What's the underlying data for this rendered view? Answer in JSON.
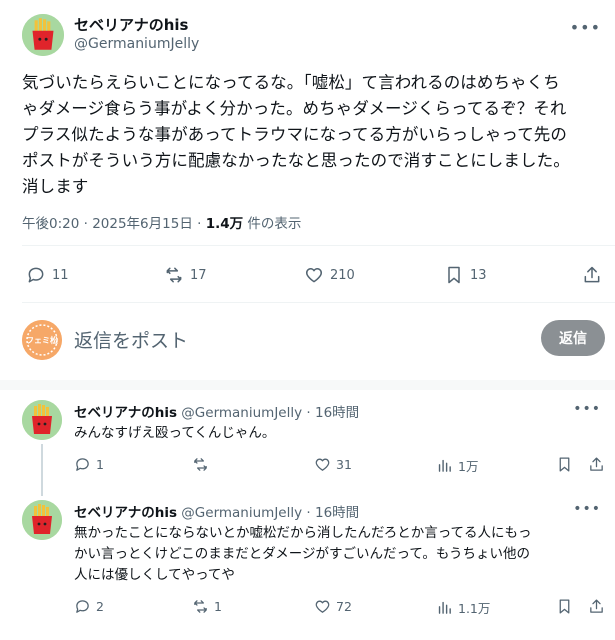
{
  "post": {
    "display_name": "セベリアナのhis",
    "handle": "@GermaniumJelly",
    "text_lines": [
      "気づいたらえらいことになってるな。「嘘松」て言われるのはめちゃくち",
      "ゃダメージ食らう事がよく分かった。めちゃダメージくらってるぞ？それ",
      "プラス似たような事があってトラウマになってる方がいらっしゃって先の",
      "ポストがそういう方に配慮なかったなと思ったので消すことにしました。",
      "消します"
    ],
    "timestamp": "午後0:20 · 2025年6月15日 · ",
    "views_count": "1.4万",
    "views_label": " 件の表示",
    "stats": {
      "replies": "11",
      "reposts": "17",
      "likes": "210",
      "bookmarks": "13"
    }
  },
  "composer": {
    "avatar_label": "フェミ松",
    "placeholder": "返信をポスト",
    "button_label": "返信"
  },
  "replies": [
    {
      "display_name": "セベリアナのhis",
      "handle_time": " @GermaniumJelly · 16時間",
      "text_lines": [
        "みんなすげえ殴ってくんじゃん。"
      ],
      "stats": {
        "replies": "1",
        "reposts": "",
        "likes": "31",
        "views": "1万"
      }
    },
    {
      "display_name": "セベリアナのhis",
      "handle_time": " @GermaniumJelly · 16時間",
      "text_lines": [
        "無かったことにならないとか嘘松だから消したんだろとか言ってる人にもっ",
        "かい言っとくけどこのままだとダメージがすごいんだって。もうちょい他の",
        "人には優しくしてやってや"
      ],
      "stats": {
        "replies": "2",
        "reposts": "1",
        "likes": "72",
        "views": "1.1万"
      }
    }
  ],
  "colors": {
    "text": "#0f1419",
    "muted": "#536471",
    "divider": "#eff3f4",
    "reply_button": "#8b9094",
    "avatar_bg": "#a8d8a0",
    "fries_box": "#e0242b",
    "fries": "#f2c23b"
  }
}
